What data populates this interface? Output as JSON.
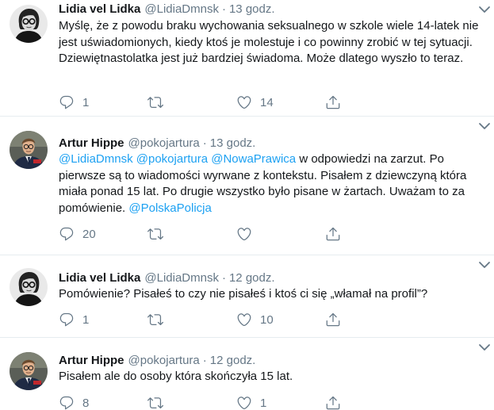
{
  "tweets": [
    {
      "name": "Lidia vel Lidka",
      "handle": "@LidiaDmnsk",
      "time": "13 godz.",
      "text": "Myślę, że z powodu braku wychowania seksualnego w szkole wiele 14-latek nie jest uświadomionych, kiedy ktoś je molestuje i co powinny zrobić w tej sytuacji. Dziewiętnastolatka jest już bardziej świadoma. Może dlatego wyszło to teraz.",
      "replies": "1",
      "retweets": "",
      "likes": "14"
    },
    {
      "name": "Artur Hippe",
      "handle": "@pokojartura",
      "time": "13 godz.",
      "mention1": "@LidiaDmnsk",
      "mention2": "@pokojartura",
      "mention3": "@NowaPrawica",
      "text_a": " w odpowiedzi na zarzut. Po pierwsze są to wiadomości wyrwane z kontekstu. Pisałem z dziewczyną która miała ponad 15 lat. Po drugie wszystko było pisane w żartach. Uważam to za pomówienie. ",
      "mention4": "@PolskaPolicja",
      "replies": "20",
      "retweets": "",
      "likes": ""
    },
    {
      "name": "Lidia vel Lidka",
      "handle": "@LidiaDmnsk",
      "time": "12 godz.",
      "text": "Pomówienie? Pisałeś to czy nie pisałeś i ktoś ci się „włamał na profil”?",
      "replies": "1",
      "retweets": "",
      "likes": "10"
    },
    {
      "name": "Artur Hippe",
      "handle": "@pokojartura",
      "time": "12 godz.",
      "text": "Pisałem ale do osoby która skończyła 15 lat.",
      "replies": "8",
      "retweets": "",
      "likes": "1"
    }
  ],
  "dot": "·",
  "icons": {
    "reply": "reply-icon",
    "retweet": "retweet-icon",
    "like": "like-icon",
    "share": "share-icon",
    "caret": "chevron-down-icon"
  },
  "colors": {
    "text": "#14171a",
    "muted": "#657786",
    "link": "#1da1f2",
    "separator": "#e6ecf0"
  }
}
